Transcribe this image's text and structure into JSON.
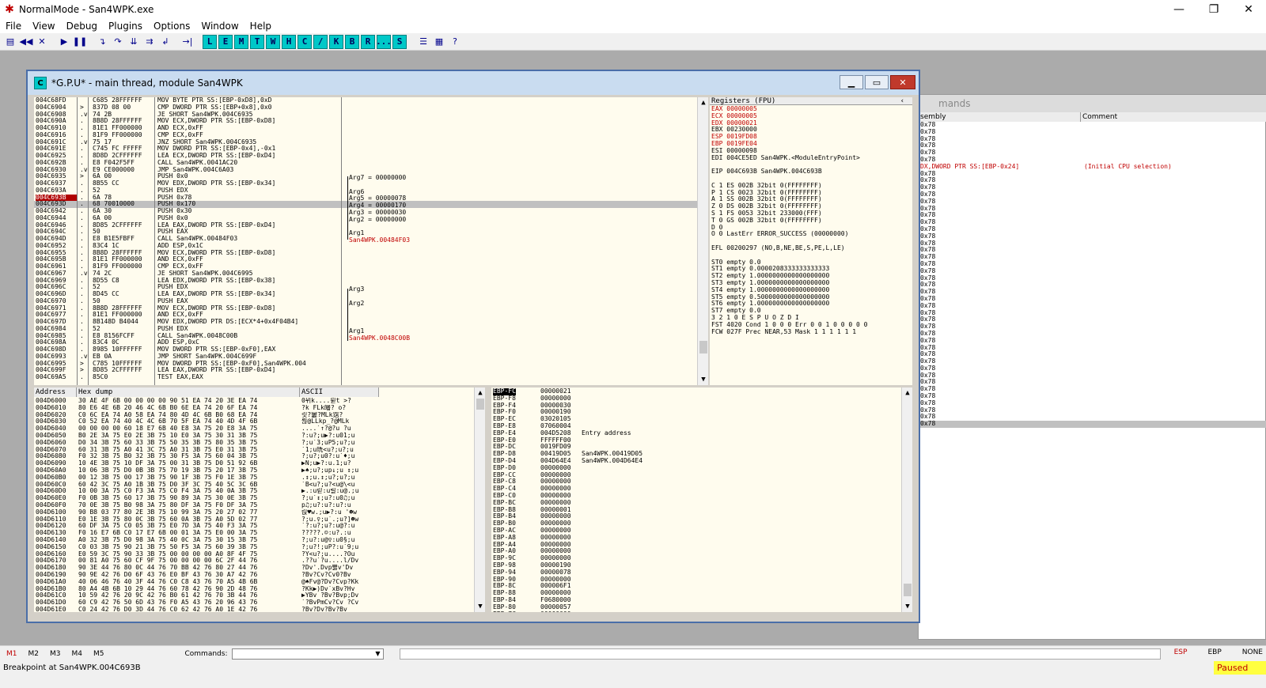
{
  "window": {
    "title": "NormalMode - San4WPK.exe"
  },
  "menu": [
    "File",
    "View",
    "Debug",
    "Plugins",
    "Options",
    "Window",
    "Help"
  ],
  "toolbar_letters": [
    "L",
    "E",
    "M",
    "T",
    "W",
    "H",
    "C",
    "/",
    "K",
    "B",
    "R",
    "...",
    "S"
  ],
  "cpu_window": {
    "title": "*G.P.U* - main thread, module San4WPK"
  },
  "disasm": [
    {
      "a": "004C68FD",
      "m": "",
      "h": "C685 28FFFFFF",
      "i": "MOV BYTE PTR SS:[EBP-0xD8],0xD"
    },
    {
      "a": "004C6904",
      "m": ">",
      "h": "837D 08 00",
      "i": "CMP DWORD PTR SS:[EBP+0x8],0x0"
    },
    {
      "a": "004C6908",
      "m": ".v",
      "h": "74 2B",
      "i": "JE SHORT San4WPK.004C6935"
    },
    {
      "a": "004C690A",
      "m": ".",
      "h": "8B8D 28FFFFFF",
      "i": "MOV ECX,DWORD PTR SS:[EBP-0xD8]"
    },
    {
      "a": "004C6910",
      "m": ".",
      "h": "81E1 FF000000",
      "i": "AND ECX,0xFF"
    },
    {
      "a": "004C6916",
      "m": ".",
      "h": "81F9 FF000000",
      "i": "CMP ECX,0xFF"
    },
    {
      "a": "004C691C",
      "m": ".v",
      "h": "75 17",
      "i": "JNZ SHORT San4WPK.004C6935"
    },
    {
      "a": "004C691E",
      "m": ".",
      "h": "C745 FC FFFFF",
      "i": "MOV DWORD PTR SS:[EBP-0x4],-0x1"
    },
    {
      "a": "004C6925",
      "m": ".",
      "h": "8D8D 2CFFFFFF",
      "i": "LEA ECX,DWORD PTR SS:[EBP-0xD4]"
    },
    {
      "a": "004C692B",
      "m": ".",
      "h": "E8 F042F5FF",
      "i": "CALL San4WPK.0041AC20"
    },
    {
      "a": "004C6930",
      "m": ".v",
      "h": "E9 CE000000",
      "i": "JMP San4WPK.004C6A03"
    },
    {
      "a": "004C6935",
      "m": ">",
      "h": "6A 00",
      "i": "PUSH 0x0"
    },
    {
      "a": "004C6937",
      "m": ".",
      "h": "8B55 CC",
      "i": "MOV EDX,DWORD PTR SS:[EBP-0x34]"
    },
    {
      "a": "004C693A",
      "m": ".",
      "h": "52",
      "i": "PUSH EDX"
    },
    {
      "a": "004C693B",
      "m": ".",
      "h": "6A 78",
      "i": "PUSH 0x78",
      "bp": true
    },
    {
      "a": "004C693D",
      "m": ".",
      "h": "68 70010000",
      "i": "PUSH 0x170",
      "cur": true
    },
    {
      "a": "004C6942",
      "m": ".",
      "h": "6A 30",
      "i": "PUSH 0x30"
    },
    {
      "a": "004C6944",
      "m": ".",
      "h": "6A 00",
      "i": "PUSH 0x0"
    },
    {
      "a": "004C6946",
      "m": ".",
      "h": "8D85 2CFFFFFF",
      "i": "LEA EAX,DWORD PTR SS:[EBP-0xD4]"
    },
    {
      "a": "004C694C",
      "m": ".",
      "h": "50",
      "i": "PUSH EAX"
    },
    {
      "a": "004C694D",
      "m": ".",
      "h": "E8 B1E5FBFF",
      "i": "CALL San4WPK.00484F03"
    },
    {
      "a": "004C6952",
      "m": ".",
      "h": "83C4 1C",
      "i": "ADD ESP,0x1C"
    },
    {
      "a": "004C6955",
      "m": ".",
      "h": "8B8D 28FFFFFF",
      "i": "MOV ECX,DWORD PTR SS:[EBP-0xD8]"
    },
    {
      "a": "004C695B",
      "m": ".",
      "h": "81E1 FF000000",
      "i": "AND ECX,0xFF"
    },
    {
      "a": "004C6961",
      "m": ".",
      "h": "81F9 FF000000",
      "i": "CMP ECX,0xFF"
    },
    {
      "a": "004C6967",
      "m": ".v",
      "h": "74 2C",
      "i": "JE SHORT San4WPK.004C6995"
    },
    {
      "a": "004C6969",
      "m": ".",
      "h": "8D55 C8",
      "i": "LEA EDX,DWORD PTR SS:[EBP-0x38]"
    },
    {
      "a": "004C696C",
      "m": ".",
      "h": "52",
      "i": "PUSH EDX"
    },
    {
      "a": "004C696D",
      "m": ".",
      "h": "8D45 CC",
      "i": "LEA EAX,DWORD PTR SS:[EBP-0x34]"
    },
    {
      "a": "004C6970",
      "m": ".",
      "h": "50",
      "i": "PUSH EAX"
    },
    {
      "a": "004C6971",
      "m": ".",
      "h": "8B8D 28FFFFFF",
      "i": "MOV ECX,DWORD PTR SS:[EBP-0xD8]"
    },
    {
      "a": "004C6977",
      "m": ".",
      "h": "81E1 FF000000",
      "i": "AND ECX,0xFF"
    },
    {
      "a": "004C697D",
      "m": ".",
      "h": "8B148D B4044",
      "i": "MOV EDX,DWORD PTR DS:[ECX*4+0x4F04B4]"
    },
    {
      "a": "004C6984",
      "m": ".",
      "h": "52",
      "i": "PUSH EDX"
    },
    {
      "a": "004C6985",
      "m": ".",
      "h": "E8 8156FCFF",
      "i": "CALL San4WPK.0048C00B"
    },
    {
      "a": "004C698A",
      "m": ".",
      "h": "83C4 0C",
      "i": "ADD ESP,0xC"
    },
    {
      "a": "004C698D",
      "m": ".",
      "h": "8985 10FFFFFF",
      "i": "MOV DWORD PTR SS:[EBP-0xF0],EAX"
    },
    {
      "a": "004C6993",
      "m": ".v",
      "h": "EB 0A",
      "i": "JMP SHORT San4WPK.004C699F"
    },
    {
      "a": "004C6995",
      "m": ">",
      "h": "C785 10FFFFFF",
      "i": "MOV DWORD PTR SS:[EBP-0xF0],San4WPK.004"
    },
    {
      "a": "004C699F",
      "m": ">",
      "h": "8D85 2CFFFFFF",
      "i": "LEA EAX,DWORD PTR SS:[EBP-0xD4]"
    },
    {
      "a": "004C69A5",
      "m": ".",
      "h": "85C0",
      "i": "TEST EAX,EAX"
    }
  ],
  "disasm_comments": {
    "arg7": "Arg7 = 00000000",
    "arg6": "Arg6",
    "arg5": "Arg5 = 00000078",
    "arg4": "Arg4 = 00000170",
    "arg3": "Arg3 = 00000030",
    "arg2": "Arg2 = 00000000",
    "arg1": "Arg1",
    "call1": "San4WPK.00484F03",
    "arg3b": "Arg3",
    "arg2b": "Arg2",
    "arg1b": "Arg1",
    "call2": "San4WPK.0048C00B"
  },
  "registers": {
    "header": "Registers (FPU)",
    "lines": [
      {
        "t": "EAX 00000005",
        "red": true
      },
      {
        "t": "ECX 00000005",
        "red": true
      },
      {
        "t": "EDX 00000021",
        "red": true
      },
      {
        "t": "EBX 00230000"
      },
      {
        "t": "ESP 0019FD08",
        "red": true
      },
      {
        "t": "EBP 0019FE04",
        "red": true
      },
      {
        "t": "ESI 00000098"
      },
      {
        "t": "EDI 004CE5ED San4WPK.<ModuleEntryPoint>"
      },
      {
        "t": ""
      },
      {
        "t": "EIP 004C693B San4WPK.004C693B"
      },
      {
        "t": ""
      },
      {
        "t": "C 1  ES 002B 32bit 0(FFFFFFFF)"
      },
      {
        "t": "P 1  CS 0023 32bit 0(FFFFFFFF)"
      },
      {
        "t": "A 1  SS 002B 32bit 0(FFFFFFFF)"
      },
      {
        "t": "Z 0  DS 002B 32bit 0(FFFFFFFF)"
      },
      {
        "t": "S 1  FS 0053 32bit 233000(FFF)"
      },
      {
        "t": "T 0  GS 002B 32bit 0(FFFFFFFF)"
      },
      {
        "t": "D 0"
      },
      {
        "t": "O 0  LastErr ERROR_SUCCESS (00000000)"
      },
      {
        "t": ""
      },
      {
        "t": "EFL 00200297 (NO,B,NE,BE,S,PE,L,LE)"
      },
      {
        "t": ""
      },
      {
        "t": "ST0 empty 0.0"
      },
      {
        "t": "ST1 empty 0.0000208333333333333"
      },
      {
        "t": "ST2 empty 1.0000000000000000000"
      },
      {
        "t": "ST3 empty 1.0000000000000000000"
      },
      {
        "t": "ST4 empty 1.0000000000000000000"
      },
      {
        "t": "ST5 empty 0.5000000000000000000"
      },
      {
        "t": "ST6 empty 1.0000000000000000000"
      },
      {
        "t": "ST7 empty 0.0"
      },
      {
        "t": "              3 2 1 0      E S P U O Z D I"
      },
      {
        "t": "FST 4020  Cond 1 0 0 0  Err 0 0 1 0 0 0 0 0"
      },
      {
        "t": "FCW 027F  Prec NEAR,53  Mask    1 1 1 1 1 1"
      }
    ]
  },
  "dump": {
    "headers": {
      "address": "Address",
      "hex": "Hex dump",
      "ascii": "ASCII"
    },
    "rows": [
      {
        "a": "004D6000",
        "h": "30 AE 4F 6B 00 00 00 00 90 51 EA 74 20 3E EA 74",
        "s": "0뮈k....륃t >?"
      },
      {
        "a": "004D6010",
        "h": "80 E6 4E 6B 20 46 4C 6B B0 6E EA 74 20 6F EA 74",
        "s": "?k FLk皤? o?"
      },
      {
        "a": "004D6020",
        "h": "C0 6C EA 74 A0 58 EA 74 80 4D 4C 6B B0 68 EA 74",
        "s": "릿?窶?MLk霑?"
      },
      {
        "a": "004D6030",
        "h": "C0 52 EA 74 40 4C 4C 6B 70 5F EA 74 40 4D 4F 6B",
        "s": "륂@LLkp_?@MLk"
      },
      {
        "a": "004D6040",
        "h": "00 00 00 00 60 18 E7 6B 40 E8 3A 75 20 E8 3A 75",
        "s": "....`↑?@?u ?u"
      },
      {
        "a": "004D6050",
        "h": "B0 2E 3A 75 E0 2E 3B 75 10 E0 3A 75 30 31 3B 75",
        "s": "?:u?;u▶?:u01;u"
      },
      {
        "a": "004D6060",
        "h": "D0 34 3B 75 60 33 3B 75 50 35 3B 75 80 35 3B 75",
        "s": "?;u`3;uP5;u?;u"
      },
      {
        "a": "004D6070",
        "h": "60 31 3B 75 A0 41 3C 75 A0 31 3B 75 E0 31 3B 75",
        "s": "`1;u珗<u?;u?;u"
      },
      {
        "a": "004D6080",
        "h": "F0 32 3B 75 B0 32 3B 75 30 F5 3A 75 60 04 3B 75",
        "s": "?;u?;u0?:u`♦;u"
      },
      {
        "a": "004D6090",
        "h": "10 4E 3B 75 10 DF 3A 75 00 31 3B 75 D0 51 92 6B",
        "s": "▶N;u▶?:u.1;u?"
      },
      {
        "a": "004D60A0",
        "h": "10 06 3B 75 D0 0B 3B 75 70 19 3B 75 20 17 3B 75",
        "s": "▶♠;u?;up↓;u ↕;u"
      },
      {
        "a": "004D60B0",
        "h": "00 12 3B 75 00 17 3B 75 90 1F 3B 75 F0 1E 3B 75",
        "s": ".↕;u.↕;u?;u?;u"
      },
      {
        "a": "004D60C0",
        "h": "60 42 3C 75 A0 1B 3B 75 D0 3F 3C 75 40 5C 3C 6B",
        "s": "`B<u?;u?<u@\\<u"
      },
      {
        "a": "004D60D0",
        "h": "10 00 3A 75 C0 F3 3A 75 C0 F4 3A 75 40 0A 3B 75",
        "s": "▶.:u릳:u릴:u@.;u"
      },
      {
        "a": "004D60E0",
        "h": "F0 0B 3B 75 60 17 3B 75 90 89 3A 75 30 0E 3B 75",
        "s": "?;u`↕;u?:u0♫;u"
      },
      {
        "a": "004D60F0",
        "h": "70 0E 3B 75 B0 98 3A 75 80 DF 3A 75 F0 DF 3A 75",
        "s": "p♫;u?:u?:u?:u"
      },
      {
        "a": "004D6100",
        "h": "90 B8 03 77 80 2E 3B 75 10 99 3A 75 20 27 02 77",
        "s": "릱♥w.;u▶?:u '☻w"
      },
      {
        "a": "004D6110",
        "h": "E0 1E 3B 75 80 0C 3B 75 60 0A 3B 75 A0 5D 02 77",
        "s": "?;u.♀;u`.;u?]☻w"
      },
      {
        "a": "004D6120",
        "h": "60 DF 3A 75 C0 05 3B 75 E0 7D 3A 75 40 F3 3A 75",
        "s": "`?:u?;u?:u@?:u"
      },
      {
        "a": "004D6130",
        "h": "F0 16 E7 6B C0 17 E7 6B 00 01 3A 75 E0 00 3A 75",
        "s": "?????.☺:u?.:u"
      },
      {
        "a": "004D6140",
        "h": "A0 32 3B 75 D0 98 3A 75 40 0C 3A 75 30 15 3B 75",
        "s": "?;u?:u@♀:u0§;u"
      },
      {
        "a": "004D6150",
        "h": "C0 03 3B 75 90 21 3B 75 50 F5 3A 75 60 39 3B 75",
        "s": "?;u?!;uP?:u`9;u"
      },
      {
        "a": "004D6160",
        "h": "E0 59 3C 75 90 33 3B 75 00 00 00 00 A0 8F 4F 75",
        "s": "?Y<u?;u....?Ou"
      },
      {
        "a": "004D6170",
        "h": "00 81 A0 75 60 CF 9F 75 00 00 00 00 6C 2F 44 76",
        "s": ".??u`?u....l/Dv"
      },
      {
        "a": "004D6180",
        "h": "90 3E 44 76 80 0C 44 76 70 BB 42 76 80 27 44 76",
        "s": "?Dv'.Dvp뻃v'Dv"
      },
      {
        "a": "004D6190",
        "h": "90 9E 42 76 D0 6F 43 76 E0 BF 43 76 30 A7 42 76",
        "s": "?Bv?Cv?Cv0?Bv"
      },
      {
        "a": "004D61A0",
        "h": "40 06 46 76 40 3F 44 76 C0 C8 43 76 70 A5 4B 6B",
        "s": "@♠Fv@?Dv?Cvp?Kk"
      },
      {
        "a": "004D61B0",
        "h": "80 A4 4B 6B 10 29 44 76 60 78 42 76 90 2D 48 76",
        "s": "?Kk▶)Dv`xBv?Hv"
      },
      {
        "a": "004D61C0",
        "h": "10 59 42 76 20 9C 42 76 B0 61 42 76 70 3B 44 76",
        "s": "▶YBv ?Bv?Bvp;Dv"
      },
      {
        "a": "004D61D0",
        "h": "60 C9 42 76 50 6D 43 76 F0 A5 43 76 20 96 43 76",
        "s": "`?BvPmCv?Cv ?Cv"
      },
      {
        "a": "004D61E0",
        "h": "C0 24 42 76 D0 3D 44 76 C0 62 42 76 A0 1E 42 76",
        "s": "?Bv?Dv?Bv?Bv"
      }
    ]
  },
  "stack": [
    {
      "k": "EBP-FC",
      "v": "00000021",
      "c": "",
      "top": true
    },
    {
      "k": "EBP-F8",
      "v": "00000000",
      "c": ""
    },
    {
      "k": "EBP-F4",
      "v": "00000030",
      "c": ""
    },
    {
      "k": "EBP-F0",
      "v": "00000190",
      "c": ""
    },
    {
      "k": "EBP-EC",
      "v": "03020105",
      "c": ""
    },
    {
      "k": "EBP-E8",
      "v": "07060004",
      "c": ""
    },
    {
      "k": "EBP-E4",
      "v": "004D5208",
      "c": "Entry address"
    },
    {
      "k": "EBP-E0",
      "v": "FFFFFF00",
      "c": ""
    },
    {
      "k": "EBP-DC",
      "v": "0019FD09",
      "c": ""
    },
    {
      "k": "EBP-D8",
      "v": "00419D05",
      "c": "San4WPK.00419D05"
    },
    {
      "k": "EBP-D4",
      "v": "004D64E4",
      "c": "San4WPK.004D64E4"
    },
    {
      "k": "EBP-D0",
      "v": "00000000",
      "c": ""
    },
    {
      "k": "EBP-CC",
      "v": "00000000",
      "c": ""
    },
    {
      "k": "EBP-C8",
      "v": "00000000",
      "c": ""
    },
    {
      "k": "EBP-C4",
      "v": "00000000",
      "c": ""
    },
    {
      "k": "EBP-C0",
      "v": "00000000",
      "c": ""
    },
    {
      "k": "EBP-BC",
      "v": "00000000",
      "c": ""
    },
    {
      "k": "EBP-B8",
      "v": "00000001",
      "c": ""
    },
    {
      "k": "EBP-B4",
      "v": "00000000",
      "c": ""
    },
    {
      "k": "EBP-B0",
      "v": "00000000",
      "c": ""
    },
    {
      "k": "EBP-AC",
      "v": "00000000",
      "c": ""
    },
    {
      "k": "EBP-A8",
      "v": "00000000",
      "c": ""
    },
    {
      "k": "EBP-A4",
      "v": "00000000",
      "c": ""
    },
    {
      "k": "EBP-A0",
      "v": "00000000",
      "c": ""
    },
    {
      "k": "EBP-9C",
      "v": "00000000",
      "c": ""
    },
    {
      "k": "EBP-98",
      "v": "00000190",
      "c": ""
    },
    {
      "k": "EBP-94",
      "v": "00000078",
      "c": ""
    },
    {
      "k": "EBP-90",
      "v": "00000000",
      "c": ""
    },
    {
      "k": "EBP-8C",
      "v": "000006F1",
      "c": ""
    },
    {
      "k": "EBP-88",
      "v": "00000000",
      "c": ""
    },
    {
      "k": "EBP-84",
      "v": "F0680000",
      "c": ""
    },
    {
      "k": "EBP-80",
      "v": "00000057",
      "c": ""
    },
    {
      "k": "EBP-7C",
      "v": "00000000",
      "c": ""
    }
  ],
  "commands_pane": {
    "title": "mands",
    "headers": [
      "sembly",
      "Comment"
    ],
    "rows": [
      {
        "a": "0x78",
        "c": ""
      },
      {
        "a": "0x78",
        "c": ""
      },
      {
        "a": "0x78",
        "c": ""
      },
      {
        "a": "0x78",
        "c": ""
      },
      {
        "a": "0x78",
        "c": ""
      },
      {
        "a": "0x78",
        "c": ""
      },
      {
        "a": "DX,DWORD PTR SS:[EBP-0x24]",
        "c": "(Initial CPU selection)",
        "red": true
      },
      {
        "a": "0x78",
        "c": ""
      },
      {
        "a": "0x78",
        "c": ""
      },
      {
        "a": "0x78",
        "c": ""
      },
      {
        "a": "0x78",
        "c": ""
      },
      {
        "a": "0x78",
        "c": ""
      },
      {
        "a": "0x78",
        "c": ""
      },
      {
        "a": "0x78",
        "c": ""
      },
      {
        "a": "0x78",
        "c": ""
      },
      {
        "a": "0x78",
        "c": ""
      },
      {
        "a": "0x78",
        "c": ""
      },
      {
        "a": "0x78",
        "c": ""
      },
      {
        "a": "0x78",
        "c": ""
      },
      {
        "a": "0x78",
        "c": ""
      },
      {
        "a": "0x78",
        "c": ""
      },
      {
        "a": "0x78",
        "c": ""
      },
      {
        "a": "0x78",
        "c": ""
      },
      {
        "a": "0x78",
        "c": ""
      },
      {
        "a": "0x78",
        "c": ""
      },
      {
        "a": "0x78",
        "c": ""
      },
      {
        "a": "0x78",
        "c": ""
      },
      {
        "a": "0x78",
        "c": ""
      },
      {
        "a": "0x78",
        "c": ""
      },
      {
        "a": "0x78",
        "c": ""
      },
      {
        "a": "0x78",
        "c": ""
      },
      {
        "a": "0x78",
        "c": ""
      },
      {
        "a": "0x78",
        "c": ""
      },
      {
        "a": "0x78",
        "c": ""
      },
      {
        "a": "0x78",
        "c": ""
      },
      {
        "a": "0x78",
        "c": ""
      },
      {
        "a": "0x78",
        "c": ""
      },
      {
        "a": "0x78",
        "c": ""
      },
      {
        "a": "0x78",
        "c": ""
      },
      {
        "a": "0x78",
        "c": ""
      },
      {
        "a": "0x78",
        "c": ""
      },
      {
        "a": "0x78",
        "c": ""
      },
      {
        "a": "0x78",
        "c": ""
      },
      {
        "a": "0x78",
        "c": "",
        "sel": true
      }
    ]
  },
  "cmdbar": {
    "markers": [
      "M1",
      "M2",
      "M3",
      "M4",
      "M5"
    ],
    "commands_label": "Commands:",
    "right": [
      "ESP",
      "EBP",
      "NONE"
    ]
  },
  "status": {
    "message": "Breakpoint at San4WPK.004C693B",
    "state": "Paused"
  },
  "colors": {
    "accent_red": "#c00000",
    "pane_bg": "#fffcee",
    "paused_bg": "#ffff40"
  }
}
